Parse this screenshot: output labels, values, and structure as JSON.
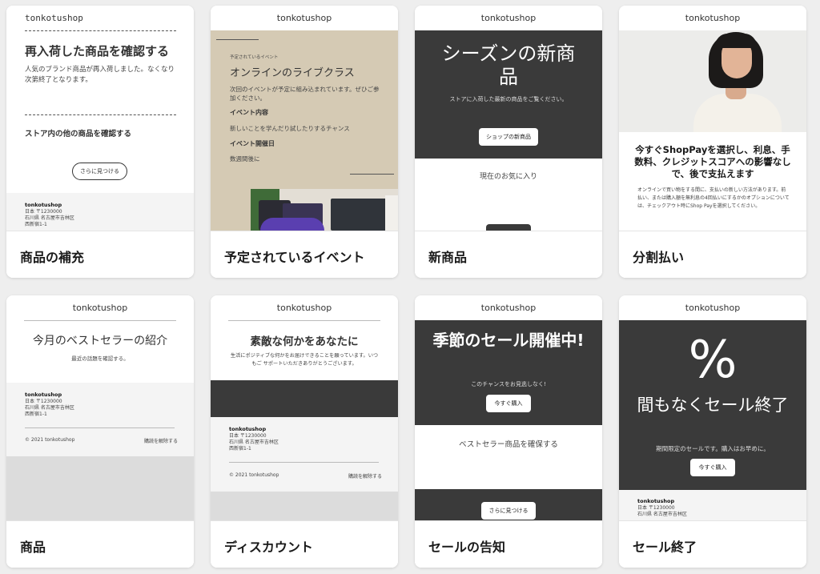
{
  "cards": [
    {
      "label": "商品の補充",
      "shop": "tonkotushop",
      "heading": "再入荷した商品を確認する",
      "body": "人気のブランド商品が再入荷しました。なくなり次第終了となります。",
      "sub": "ストア内の他の商品を確認する",
      "button": "さらに見つける",
      "footer": {
        "name": "tonkotushop",
        "line1": "日本 〒1230000",
        "line2": "石川県 名古屋市吉林区",
        "line3": "西新宿1-1"
      }
    },
    {
      "label": "予定されているイベント",
      "shop": "tonkotushop",
      "tag": "予定されているイベント",
      "heading": "オンラインのライブクラス",
      "body": "次回のイベントが予定に組み込まれています。ぜひご参加ください。",
      "content_label": "イベント内容",
      "content_text": "新しいことを学んだり試したりするチャンス",
      "date_label": "イベント開催日",
      "date_text": "数週間後に"
    },
    {
      "label": "新商品",
      "shop": "tonkotushop",
      "heading": "シーズンの新商品",
      "body": "ストアに入荷した最新の商品をご覧ください。",
      "button": "ショップの新商品",
      "sub": "現在のお気に入り"
    },
    {
      "label": "分割払い",
      "shop": "tonkotushop",
      "heading": "今すぐShopPayを選択し、利息、手数料、クレジットスコアへの影響なしで、後で支払えます",
      "body": "オンラインで買い物をする間に、支払いの新しい方法があります。前払い、または購入額を無利息の4回払いにするかのオプションについては、チェックアウト時にShop Payを選択してください。"
    },
    {
      "label": "商品",
      "shop": "tonkotushop",
      "heading": "今月のベストセラーの紹介",
      "body": "最近の話題を確認する。",
      "footer": {
        "name": "tonkotushop",
        "line1": "日本 〒1230000",
        "line2": "石川県 名古屋市吉林区",
        "line3": "西新宿1-1"
      },
      "copyright": "© 2021 tonkotushop",
      "unsubscribe": "購読を解除する"
    },
    {
      "label": "ディスカウント",
      "shop": "tonkotushop",
      "heading": "素敵な何かをあなたに",
      "body": "生活にポジティブな何かをお届けできることを願っています。いつもご サポートいただきありがとうございます。",
      "footer": {
        "name": "tonkotushop",
        "line1": "日本 〒1230000",
        "line2": "石川県 名古屋市吉林区",
        "line3": "西新宿1-1"
      },
      "copyright": "© 2021 tonkotushop",
      "unsubscribe": "購読を解除する"
    },
    {
      "label": "セールの告知",
      "shop": "tonkotushop",
      "heading": "季節のセール開催中!",
      "body": "このチャンスをお見逃しなく!",
      "button": "今すぐ購入",
      "sub": "ベストセラー商品を確保する",
      "button2": "さらに見つける"
    },
    {
      "label": "セール終了",
      "shop": "tonkotushop",
      "symbol": "%",
      "heading": "間もなくセール終了",
      "body": "期間限定のセールです。購入はお早めに。",
      "button": "今すぐ購入",
      "footer": {
        "name": "tonkotushop",
        "line1": "日本 〒1230000",
        "line2": "石川県 名古屋市吉林区"
      }
    }
  ],
  "colors": {
    "dark": "#3a3a3a",
    "beige": "#d5cab4",
    "footer_bg": "#f4f4f4",
    "gray_block": "#dcdcdc"
  }
}
